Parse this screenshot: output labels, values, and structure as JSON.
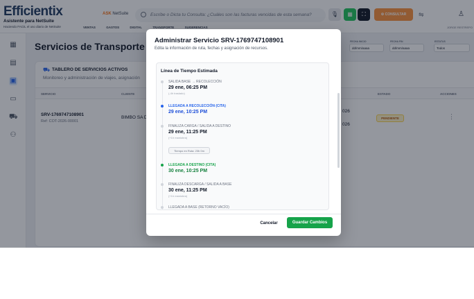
{
  "header": {
    "brand": "Efficientix",
    "brand_sub1": "Asistente para NetSuite",
    "brand_sub2": "Haciendo FACIL el uso diario de NetSuite",
    "ask_prefix": "ASK",
    "ask_suffix": "NetSuite",
    "search_placeholder": "Escribe o Dicta tu Consulta: ¿Cuáles son las facturas vencidas de esta semana?",
    "orange_button": "⚙ CONSULTAR",
    "user_name": "JORGE RESTREPO",
    "nav": [
      "VENTAS",
      "GASTOS",
      "DIGITAL",
      "TRANSPORTE",
      "SUGERENCIAS"
    ]
  },
  "page": {
    "title": "Servicios de Transporte",
    "filters": {
      "start_label": "FECHA INICIO",
      "start_value": "dd/mm/aaaa",
      "end_label": "FECHA FIN",
      "end_value": "dd/mm/aaaa",
      "status_label": "ESTATUS",
      "status_value": "Todos"
    }
  },
  "card": {
    "title": "TABLERO DE SERVICIOS ACTIVOS",
    "subtitle": "Monitoreo y administración de viajes, asignación",
    "columns": [
      "SERVICIO",
      "CLIENTE",
      "ESTADO",
      "ACCIONES"
    ],
    "row": {
      "service": "SRV-1769747108901",
      "ref": "Ref: COT-2026-00001",
      "client": "BIMBO SA D",
      "date1": "026",
      "date2": "026",
      "status": "PENDIENTE"
    }
  },
  "modal": {
    "title": "Administrar Servicio SRV-1769747108901",
    "subtitle": "Edita la información de ruta, fechas y asignación de recursos.",
    "timeline_heading": "Línea de Tiempo Estimada",
    "items": [
      {
        "label": "SALIDA BASE → RECOLECCIÓN",
        "time": "29 ene, 06:25 PM",
        "note": "(-4h traslado)",
        "color": "gray"
      },
      {
        "label": "LLEGADA A RECOLECCIÓN (CITA)",
        "time": "29 ene, 10:25 PM",
        "note": "",
        "color": "blue"
      },
      {
        "label": "FINALIZA CARGA / SALIDA A DESTINO",
        "time": "29 ene, 11:25 PM",
        "note": "(+1h maniobra)",
        "color": "gray"
      },
      {
        "label": "LLEGADA A DESTINO (CITA)",
        "time": "30 ene, 10:25 PM",
        "note": "",
        "color": "green"
      },
      {
        "label": "FINALIZA DESCARGA / SALIDA A BASE",
        "time": "30 ene, 11:25 PM",
        "note": "(+1h maniobra)",
        "color": "gray"
      },
      {
        "label": "LLEGADA A BASE (RETORNO VACÍO)",
        "time": "",
        "note": "",
        "color": "gray"
      }
    ],
    "transit_chip": "Tiempo en Ruta: 23h 0m",
    "cancel": "Cancelar",
    "save": "Guardar Cambios"
  }
}
